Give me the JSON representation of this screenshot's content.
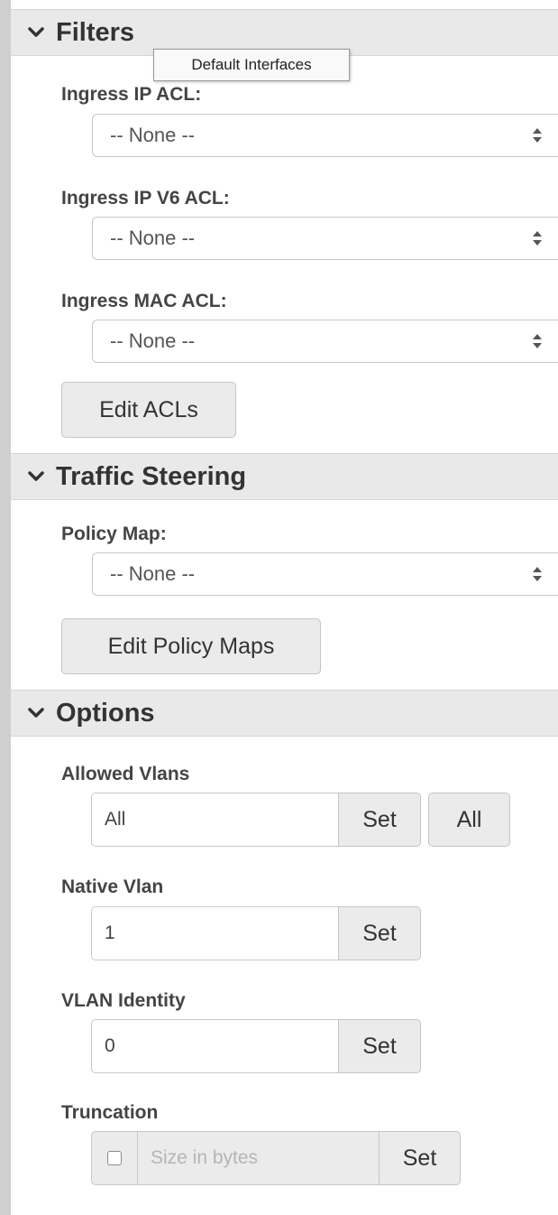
{
  "colors": {
    "header_bg": "#e9e9e9",
    "button_bg": "#ebebeb",
    "border": "#c8c8c8",
    "left_bar": "#cfcfcf"
  },
  "filters": {
    "title": "Filters",
    "tooltip": "Default Interfaces",
    "ingress_ip_acl": {
      "label": "Ingress IP ACL:",
      "value": "-- None --"
    },
    "ingress_ipv6_acl": {
      "label": "Ingress IP V6 ACL:",
      "value": "-- None --"
    },
    "ingress_mac_acl": {
      "label": "Ingress MAC ACL:",
      "value": "-- None --"
    },
    "edit_button": "Edit ACLs"
  },
  "traffic_steering": {
    "title": "Traffic Steering",
    "policy_map": {
      "label": "Policy Map:",
      "value": "-- None --"
    },
    "edit_button": "Edit Policy Maps"
  },
  "options": {
    "title": "Options",
    "allowed_vlans": {
      "label": "Allowed Vlans",
      "value": "All",
      "set_label": "Set",
      "all_label": "All"
    },
    "native_vlan": {
      "label": "Native Vlan",
      "value": "1",
      "set_label": "Set"
    },
    "vlan_identity": {
      "label": "VLAN Identity",
      "value": "0",
      "set_label": "Set"
    },
    "truncation": {
      "label": "Truncation",
      "placeholder": "Size in bytes",
      "set_label": "Set"
    }
  }
}
